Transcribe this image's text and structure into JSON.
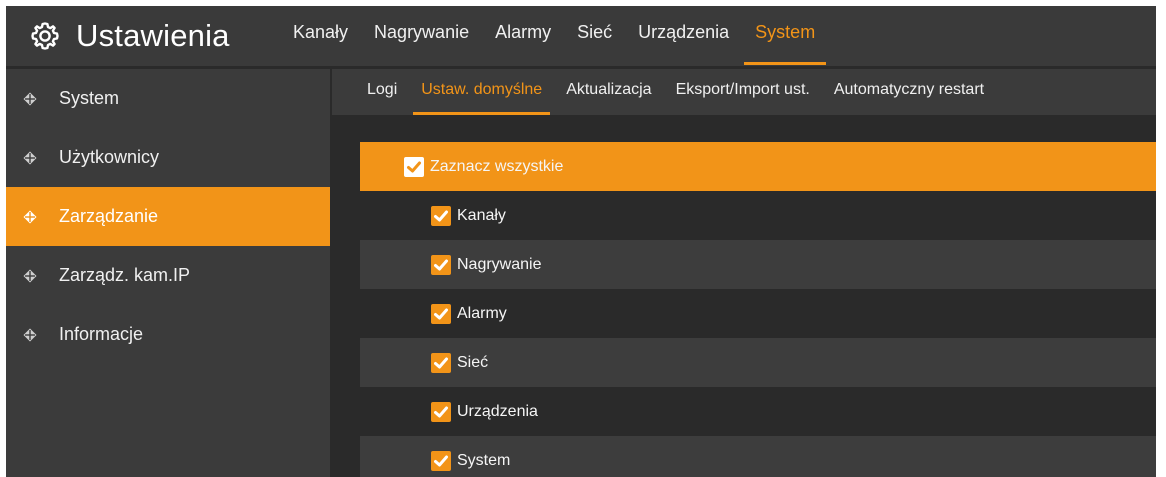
{
  "header": {
    "title": "Ustawienia",
    "icon": "gear-icon",
    "tabs": [
      {
        "label": "Kanały",
        "active": false
      },
      {
        "label": "Nagrywanie",
        "active": false
      },
      {
        "label": "Alarmy",
        "active": false
      },
      {
        "label": "Sieć",
        "active": false
      },
      {
        "label": "Urządzenia",
        "active": false
      },
      {
        "label": "System",
        "active": true
      }
    ]
  },
  "sidebar": {
    "items": [
      {
        "label": "System",
        "active": false,
        "icon": "diamond-crosshair-icon"
      },
      {
        "label": "Użytkownicy",
        "active": false,
        "icon": "diamond-crosshair-icon"
      },
      {
        "label": "Zarządzanie",
        "active": true,
        "icon": "diamond-crosshair-icon"
      },
      {
        "label": "Zarządz. kam.IP",
        "active": false,
        "icon": "diamond-crosshair-icon"
      },
      {
        "label": "Informacje",
        "active": false,
        "icon": "diamond-crosshair-icon"
      }
    ]
  },
  "subtabs": [
    {
      "label": "Logi",
      "active": false
    },
    {
      "label": "Ustaw. domyślne",
      "active": true
    },
    {
      "label": "Aktualizacja",
      "active": false
    },
    {
      "label": "Eksport/Import ust.",
      "active": false
    },
    {
      "label": "Automatyczny restart",
      "active": false
    }
  ],
  "defaults": {
    "select_all": {
      "label": "Zaznacz wszystkie",
      "checked": true
    },
    "items": [
      {
        "label": "Kanały",
        "checked": true
      },
      {
        "label": "Nagrywanie",
        "checked": true
      },
      {
        "label": "Alarmy",
        "checked": true
      },
      {
        "label": "Sieć",
        "checked": true
      },
      {
        "label": "Urządzenia",
        "checked": true
      },
      {
        "label": "System",
        "checked": true
      }
    ]
  },
  "colors": {
    "accent": "#f29418",
    "background": "#2a2a2a",
    "panel": "#3b3b3b",
    "row_light": "#3d3d3d"
  }
}
